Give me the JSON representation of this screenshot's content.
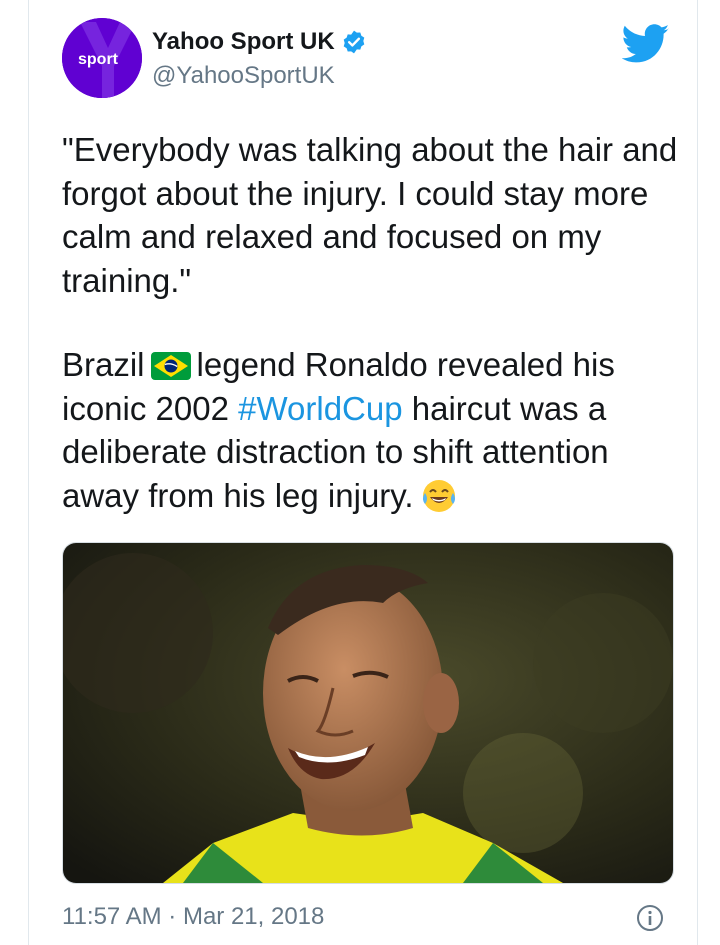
{
  "account": {
    "display_name": "Yahoo Sport UK",
    "handle": "@YahooSportUK",
    "avatar_text": "sport",
    "verified": true
  },
  "tweet": {
    "quote": "\"Everybody was talking about the hair and forgot about the injury. I could stay more calm and relaxed and focused on my training.\"",
    "body_part1": "Brazil",
    "body_part2": "legend Ronaldo revealed his iconic 2002",
    "hashtag": "#WorldCup",
    "body_part3": "haircut was a deliberate distraction to shift attention away from his leg injury.",
    "flag_icon": "brazil-flag-emoji",
    "emoji_icon": "tears-of-joy-emoji"
  },
  "meta": {
    "timestamp": "11:57 AM · Mar 21, 2018"
  },
  "colors": {
    "brand": "#6001d2",
    "link": "#1b95e0",
    "muted": "#657786",
    "twitter_blue": "#1da1f2"
  }
}
